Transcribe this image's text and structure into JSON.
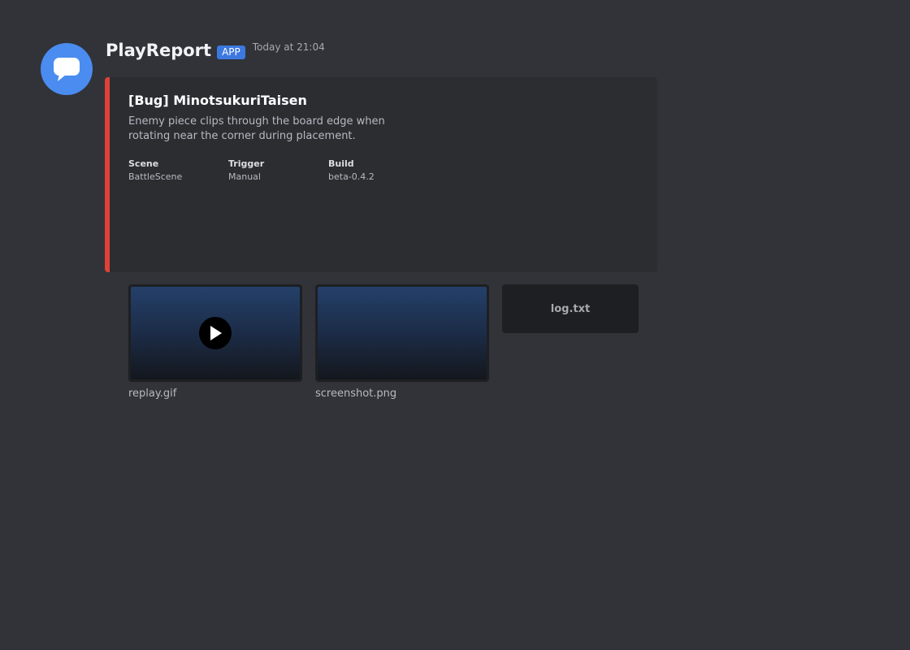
{
  "message": {
    "author": "PlayReport",
    "badge": "APP",
    "timestamp": "Today at 21:04",
    "avatar_color": "#4a8cf0",
    "avatar_icon": "speech-bubble-icon"
  },
  "embed": {
    "accent_color": "#e04136",
    "title": "[Bug] MinotsukuriTaisen",
    "description": "Enemy piece clips through the board edge when rotating near the corner during placement.",
    "fields": [
      {
        "name": "Scene",
        "value": "BattleScene"
      },
      {
        "name": "Trigger",
        "value": "Manual"
      },
      {
        "name": "Build",
        "value": "beta-0.4.2"
      }
    ]
  },
  "attachments": [
    {
      "filename": "replay.gif",
      "type": "video",
      "icon": "play-icon"
    },
    {
      "filename": "screenshot.png",
      "type": "image"
    },
    {
      "filename": "log.txt",
      "type": "file"
    }
  ]
}
